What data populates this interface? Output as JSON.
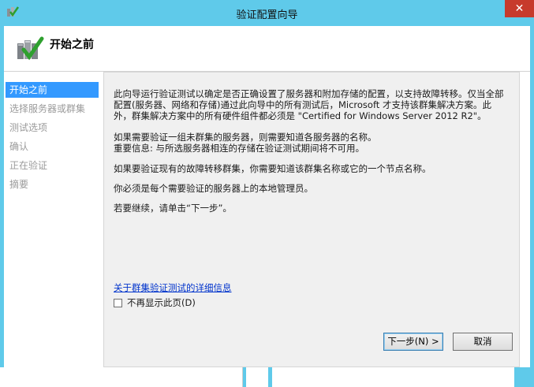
{
  "window": {
    "title": "验证配置向导",
    "close_glyph": "✕"
  },
  "header": {
    "title": "开始之前",
    "icon": "cluster-validation-check-icon"
  },
  "nav": {
    "items": [
      {
        "label": "开始之前",
        "active": true
      },
      {
        "label": "选择服务器或群集",
        "active": false
      },
      {
        "label": "测试选项",
        "active": false
      },
      {
        "label": "确认",
        "active": false
      },
      {
        "label": "正在验证",
        "active": false
      },
      {
        "label": "摘要",
        "active": false
      }
    ]
  },
  "content": {
    "para1": "此向导运行验证测试以确定是否正确设置了服务器和附加存储的配置，以支持故障转移。仅当全部配置(服务器、网络和存储)通过此向导中的所有测试后，Microsoft 才支持该群集解决方案。此外，群集解决方案中的所有硬件组件都必须是 \"Certified for Windows Server 2012 R2\"。",
    "para2_line1": "如果需要验证一组未群集的服务器，则需要知道各服务器的名称。",
    "para2_line2": "重要信息: 与所选服务器相连的存储在验证测试期间将不可用。",
    "para3": "如果要验证现有的故障转移群集，你需要知道该群集名称或它的一个节点名称。",
    "para4": "你必须是每个需要验证的服务器上的本地管理员。",
    "para5": "若要继续，请单击“下一步”。",
    "link": "关于群集验证测试的详细信息",
    "checkbox_label": "不再显示此页(D)",
    "checkbox_checked": false
  },
  "buttons": {
    "next": "下一步(N) >",
    "cancel": "取消"
  },
  "colors": {
    "frame": "#5fcaea",
    "nav_active": "#3399ff",
    "close": "#c73a2c"
  }
}
